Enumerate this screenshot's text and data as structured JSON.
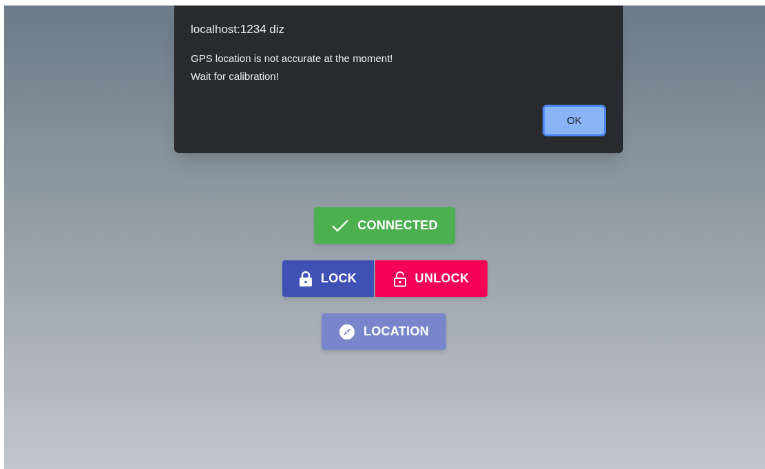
{
  "dialog": {
    "title": "localhost:1234 diz",
    "message": [
      "GPS location is not accurate at the moment!",
      "Wait for calibration!"
    ],
    "button": {
      "label": "OK",
      "focused": true
    }
  },
  "rows": [
    [
      {
        "kind": "check",
        "label": "CONNECTED",
        "color": "#4caf50"
      }
    ],
    [
      {
        "kind": "lock",
        "label": "LOCK",
        "color": "#3f51b5"
      },
      {
        "kind": "unlock",
        "label": "UNLOCK",
        "color": "#f50057"
      }
    ],
    [
      {
        "kind": "compass",
        "label": "LOCATION",
        "color": "#7986cb"
      }
    ]
  ]
}
